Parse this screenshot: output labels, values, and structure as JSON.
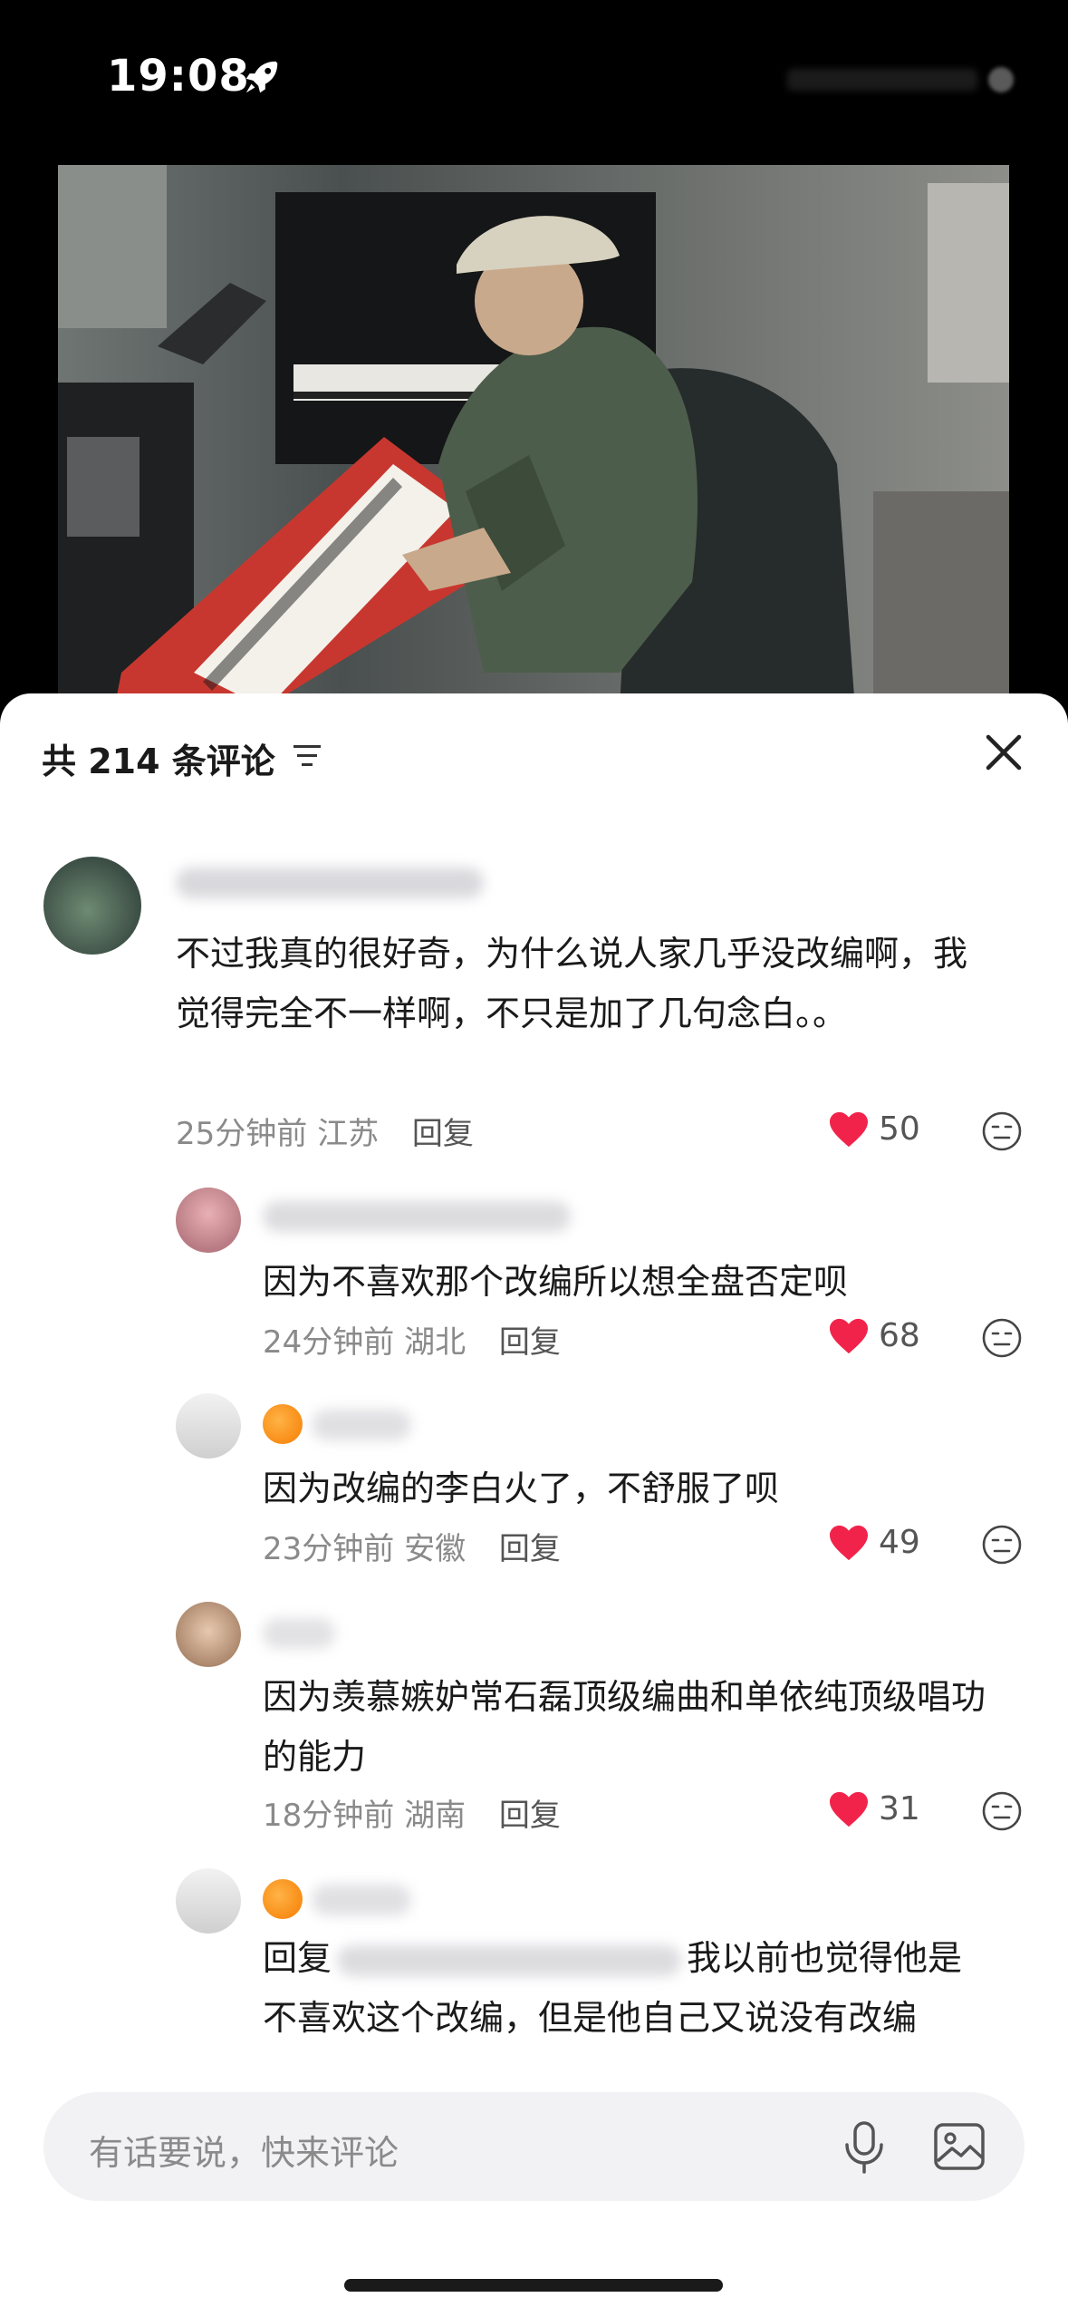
{
  "status_bar": {
    "time": "19:08"
  },
  "comments_panel": {
    "count_label": "共 214 条评论",
    "comments": [
      {
        "text": "不过我真的很好奇，为什么说人家几乎没改编啊，我觉得完全不一样啊，不只是加了几句念白。。",
        "time": "25分钟前",
        "location": "江苏",
        "reply_label": "回复",
        "likes": "50"
      },
      {
        "text": "因为不喜欢那个改编所以想全盘否定呗",
        "time": "24分钟前",
        "location": "湖北",
        "reply_label": "回复",
        "likes": "68"
      },
      {
        "text": "因为改编的李白火了，不舒服了呗",
        "time": "23分钟前",
        "location": "安徽",
        "reply_label": "回复",
        "likes": "49"
      },
      {
        "text": "因为羡慕嫉妒常石磊顶级编曲和单依纯顶级唱功的能力",
        "time": "18分钟前",
        "location": "湖南",
        "reply_label": "回复",
        "likes": "31"
      },
      {
        "reply_prefix": "回复",
        "text_part1": "我以前也觉得他是",
        "text_part2": "不喜欢这个改编，但是他自己又说没有改编"
      }
    ]
  },
  "input": {
    "placeholder": "有话要说，快来评论"
  },
  "colors": {
    "like_red": "#f2234b",
    "accent": "#1a1a1a"
  },
  "icons": [
    "rocket-icon",
    "sort-icon",
    "close-icon",
    "heart-icon",
    "dislike-face-icon",
    "mic-icon",
    "image-icon"
  ]
}
